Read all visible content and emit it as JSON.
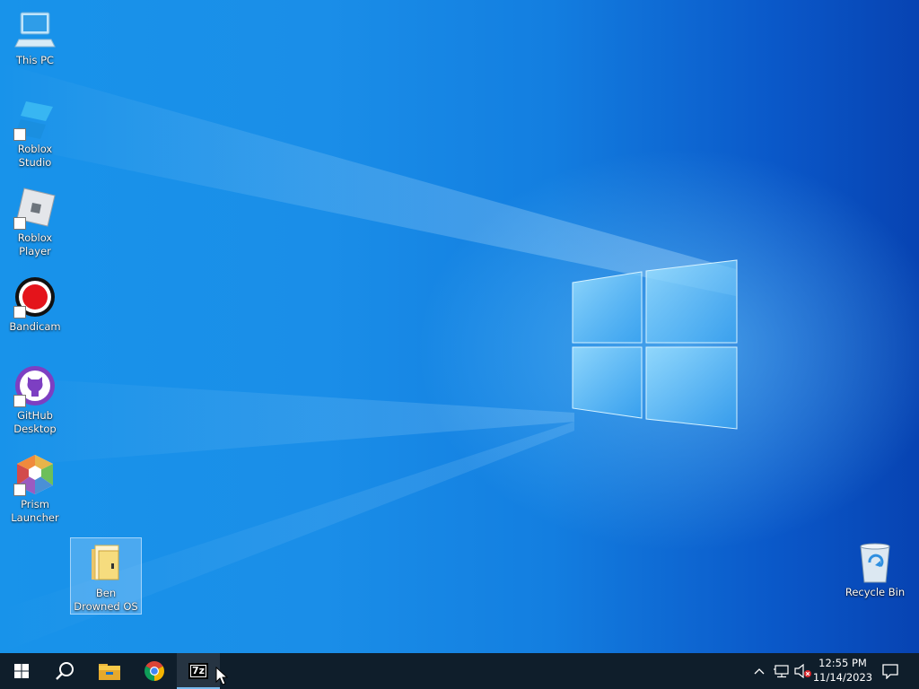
{
  "desktop": {
    "icons": [
      {
        "label": "This PC",
        "icon": "this-pc-icon"
      },
      {
        "label": "Roblox Studio",
        "icon": "roblox-studio-icon"
      },
      {
        "label": "Roblox Player",
        "icon": "roblox-player-icon"
      },
      {
        "label": "Bandicam",
        "icon": "bandicam-icon"
      },
      {
        "label": "GitHub Desktop",
        "icon": "github-desktop-icon"
      },
      {
        "label": "Prism Launcher",
        "icon": "prism-launcher-icon"
      },
      {
        "label": "Ben Drowned OS",
        "icon": "folder-icon",
        "selected": true
      },
      {
        "label": "Recycle Bin",
        "icon": "recycle-bin-icon"
      }
    ]
  },
  "taskbar": {
    "pinned": [
      {
        "name": "start",
        "icon": "windows-logo-icon"
      },
      {
        "name": "search",
        "icon": "search-icon"
      },
      {
        "name": "file-explorer",
        "icon": "file-explorer-icon"
      },
      {
        "name": "chrome",
        "icon": "chrome-icon"
      },
      {
        "name": "7-zip",
        "icon": "7zip-icon",
        "label": "7z",
        "active": true
      }
    ],
    "tray": {
      "icons": [
        "chevron-up-icon",
        "network-icon",
        "volume-muted-icon"
      ],
      "time": "12:55 PM",
      "date": "11/14/2023",
      "notification_icon": "action-center-icon"
    }
  },
  "colors": {
    "wallpaper_light": "#1893ea",
    "wallpaper_dark": "#0743b2",
    "taskbar": "#0f1e2b",
    "accent": "#76b9ed"
  }
}
